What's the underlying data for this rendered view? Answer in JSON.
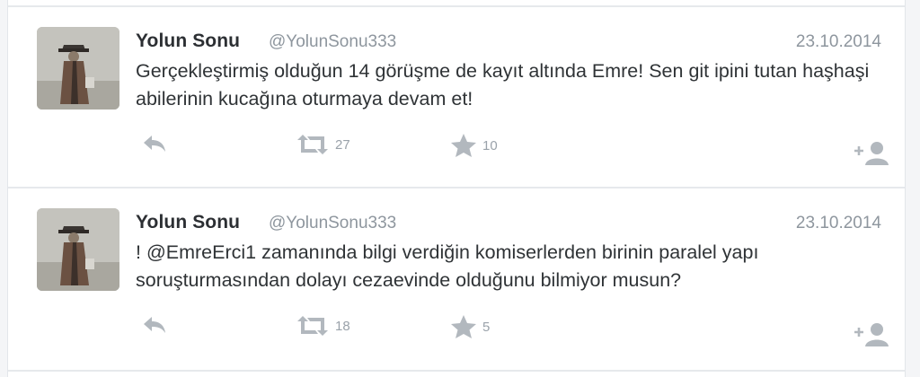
{
  "tweets": [
    {
      "name": "Yolun Sonu",
      "handle": "@YolunSonu333",
      "date": "23.10.2014",
      "text": "Gerçekleştirmiş olduğun 14 görüşme de kayıt altında Emre! Sen git ipini tutan haşhaşi abilerinin kucağına oturmaya devam et!",
      "retweets": "27",
      "favorites": "10"
    },
    {
      "name": "Yolun Sonu",
      "handle": "@YolunSonu333",
      "date": "23.10.2014",
      "text": "! @EmreErci1 zamanında bilgi verdiğin komiserlerden birinin paralel yapı soruşturmasından dolayı cezaevinde olduğunu bilmiyor musun?",
      "retweets": "18",
      "favorites": "5"
    }
  ],
  "icons": {
    "reply": "reply-icon",
    "retweet": "retweet-icon",
    "favorite": "star-icon",
    "follow": "follow-icon"
  },
  "colors": {
    "text": "#2f3336",
    "muted": "#8e969e",
    "icon": "#b2b8be"
  }
}
